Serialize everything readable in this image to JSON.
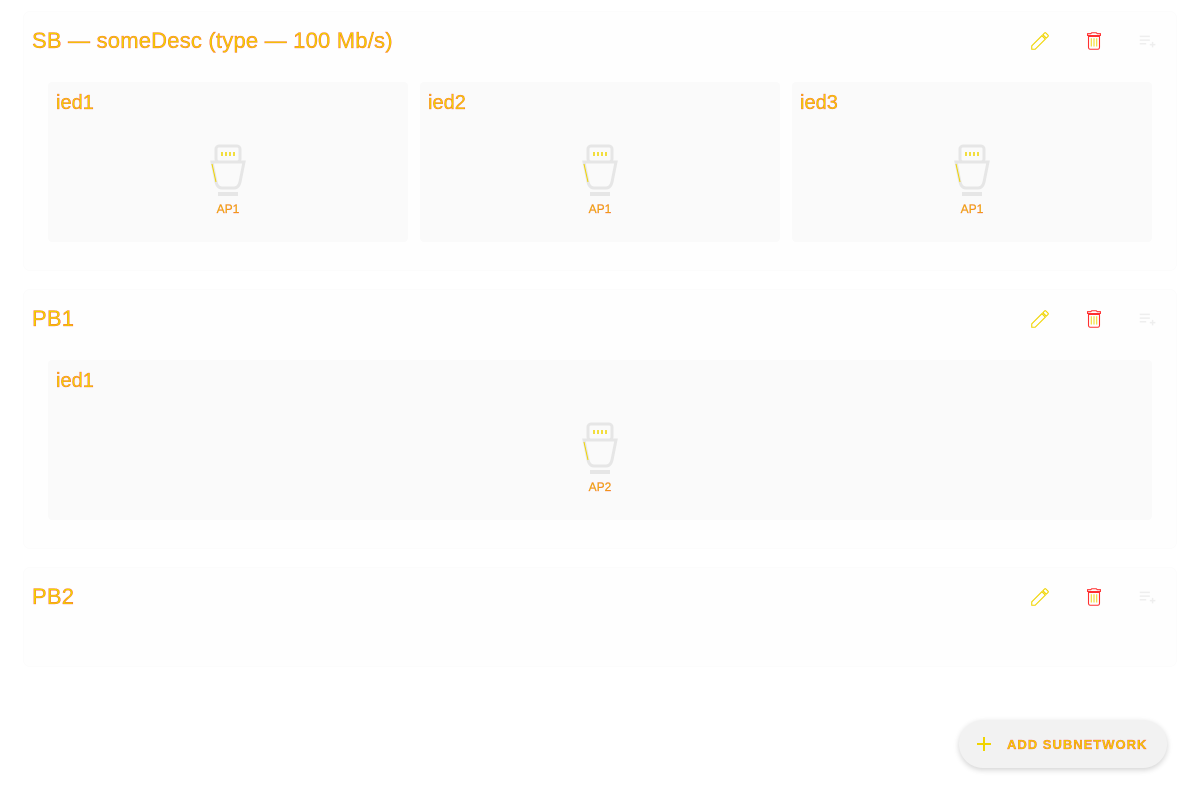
{
  "subnetworks": [
    {
      "title": "SB — someDesc (type — 100 Mb/s)",
      "actions": [
        "edit-icon",
        "delete-icon",
        "playlist-add-icon"
      ],
      "ieds": [
        {
          "name": "ied1",
          "ap": "AP1"
        },
        {
          "name": "ied2",
          "ap": "AP1"
        },
        {
          "name": "ied3",
          "ap": "AP1"
        }
      ]
    },
    {
      "title": "PB1",
      "actions": [
        "edit-icon",
        "delete-icon",
        "playlist-add-icon"
      ],
      "ieds": [
        {
          "name": "ied1",
          "ap": "AP2"
        }
      ]
    },
    {
      "title": "PB2",
      "actions": [
        "edit-icon",
        "delete-icon",
        "playlist-add-icon"
      ],
      "ieds": []
    }
  ],
  "fab": {
    "label": "ADD SUBNETWORK",
    "icon": "plus-icon"
  },
  "colors": {
    "text": "#f0d400",
    "text_outline": "#ff3030",
    "card": "#fafafa",
    "fab_bg": "#f2f2f2"
  }
}
